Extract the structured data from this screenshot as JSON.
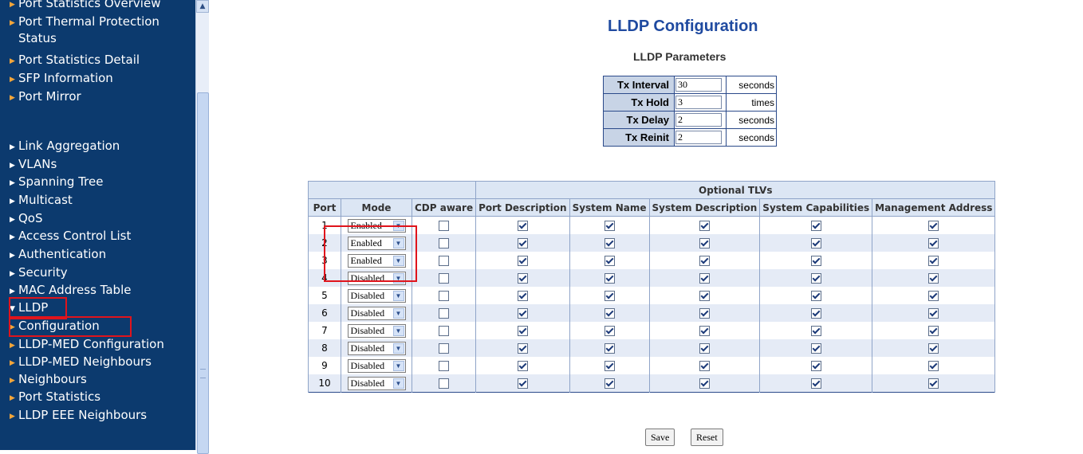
{
  "sidebar": {
    "items": [
      {
        "label": "Port Statistics Overview",
        "label2": ""
      },
      {
        "label": "Port Thermal Protection",
        "label2": "Status"
      },
      {
        "label": "Port Statistics Detail",
        "label2": ""
      },
      {
        "label": "SFP Information",
        "label2": ""
      },
      {
        "label": "Port Mirror",
        "label2": ""
      },
      {
        "label": "Link Aggregation",
        "label2": ""
      },
      {
        "label": "VLANs",
        "label2": ""
      },
      {
        "label": "Spanning Tree",
        "label2": ""
      },
      {
        "label": "Multicast",
        "label2": ""
      },
      {
        "label": "QoS",
        "label2": ""
      },
      {
        "label": "Access Control List",
        "label2": ""
      },
      {
        "label": "Authentication",
        "label2": ""
      },
      {
        "label": "Security",
        "label2": ""
      },
      {
        "label": "MAC Address Table",
        "label2": ""
      },
      {
        "label": "LLDP",
        "label2": ""
      },
      {
        "label": "Configuration",
        "label2": ""
      },
      {
        "label": "LLDP-MED Configuration",
        "label2": ""
      },
      {
        "label": "LLDP-MED Neighbours",
        "label2": ""
      },
      {
        "label": "Neighbours",
        "label2": ""
      },
      {
        "label": "Port Statistics",
        "label2": ""
      },
      {
        "label": "LLDP EEE Neighbours",
        "label2": ""
      }
    ]
  },
  "page": {
    "title": "LLDP Configuration",
    "params_title": "LLDP Parameters"
  },
  "params": [
    {
      "label": "Tx Interval",
      "value": "30",
      "unit": "seconds"
    },
    {
      "label": "Tx Hold",
      "value": "3",
      "unit": "times"
    },
    {
      "label": "Tx Delay",
      "value": "2",
      "unit": "seconds"
    },
    {
      "label": "Tx Reinit",
      "value": "2",
      "unit": "seconds"
    }
  ],
  "ports_table": {
    "group_header": "Optional TLVs",
    "columns": [
      "Port",
      "Mode",
      "CDP aware",
      "Port Description",
      "System Name",
      "System Description",
      "System Capabilities",
      "Management Address"
    ],
    "rows": [
      {
        "port": "1",
        "mode": "Enabled",
        "cdp": false,
        "tlvs": [
          true,
          true,
          true,
          true,
          true
        ]
      },
      {
        "port": "2",
        "mode": "Enabled",
        "cdp": false,
        "tlvs": [
          true,
          true,
          true,
          true,
          true
        ]
      },
      {
        "port": "3",
        "mode": "Enabled",
        "cdp": false,
        "tlvs": [
          true,
          true,
          true,
          true,
          true
        ]
      },
      {
        "port": "4",
        "mode": "Disabled",
        "cdp": false,
        "tlvs": [
          true,
          true,
          true,
          true,
          true
        ]
      },
      {
        "port": "5",
        "mode": "Disabled",
        "cdp": false,
        "tlvs": [
          true,
          true,
          true,
          true,
          true
        ]
      },
      {
        "port": "6",
        "mode": "Disabled",
        "cdp": false,
        "tlvs": [
          true,
          true,
          true,
          true,
          true
        ]
      },
      {
        "port": "7",
        "mode": "Disabled",
        "cdp": false,
        "tlvs": [
          true,
          true,
          true,
          true,
          true
        ]
      },
      {
        "port": "8",
        "mode": "Disabled",
        "cdp": false,
        "tlvs": [
          true,
          true,
          true,
          true,
          true
        ]
      },
      {
        "port": "9",
        "mode": "Disabled",
        "cdp": false,
        "tlvs": [
          true,
          true,
          true,
          true,
          true
        ]
      },
      {
        "port": "10",
        "mode": "Disabled",
        "cdp": false,
        "tlvs": [
          true,
          true,
          true,
          true,
          true
        ]
      }
    ]
  },
  "buttons": {
    "save": "Save",
    "reset": "Reset"
  },
  "icons": {
    "nav_arrow": "triangle-right-icon",
    "expanded_arrow": "triangle-down-icon",
    "dropdown": "chevron-down-icon",
    "checkbox": "checkbox-icon"
  },
  "colors": {
    "sidebar_bg": "#0c3a6e",
    "title_blue": "#1f4aa0",
    "header_bg": "#dce6f4",
    "param_label_bg": "#c8d4e6",
    "highlight_red": "#e0141c"
  }
}
